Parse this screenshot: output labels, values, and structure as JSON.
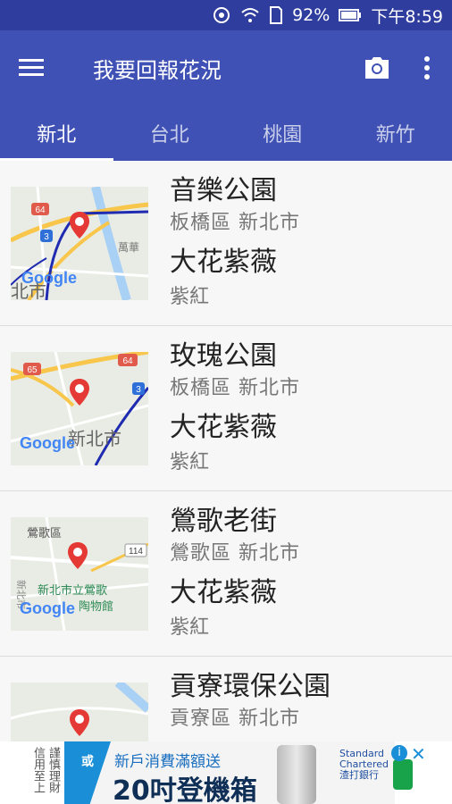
{
  "status": {
    "battery": "92%",
    "time": "下午8:59"
  },
  "appbar": {
    "title": "我要回報花況"
  },
  "tabs": [
    "新北",
    "台北",
    "桃園",
    "新竹"
  ],
  "items": [
    {
      "park": "音樂公園",
      "district": "板橋區 新北市",
      "flower": "大花紫薇",
      "color": "紫紅",
      "map_labels": {
        "a": "64",
        "b": "3",
        "c": "萬華",
        "d": "北市",
        "logo": "Google"
      }
    },
    {
      "park": "玫瑰公園",
      "district": "板橋區 新北市",
      "flower": "大花紫薇",
      "color": "紫紅",
      "map_labels": {
        "a": "65",
        "b": "64",
        "c": "3",
        "d": "新北市",
        "logo": "Google"
      }
    },
    {
      "park": "鶯歌老街",
      "district": "鶯歌區 新北市",
      "flower": "大花紫薇",
      "color": "紫紅",
      "map_labels": {
        "a": "鶯歌區",
        "b": "114",
        "c": "新北市立鶯歌",
        "d": "陶物館",
        "e": "新北市",
        "logo": "Google"
      }
    },
    {
      "park": "貢寮環保公園",
      "district": "貢寮區 新北市",
      "flower": "",
      "color": ""
    }
  ],
  "ad": {
    "left_text": "謹慎理財 信用至上",
    "or_label": "或",
    "line1": "新戶消費滿額送",
    "line2": "20吋登機箱",
    "brand": "Standard Chartered 渣打銀行"
  },
  "colors": {
    "primary": "#3f51b5",
    "status": "#2f3e9e",
    "marker": "#e53935"
  }
}
